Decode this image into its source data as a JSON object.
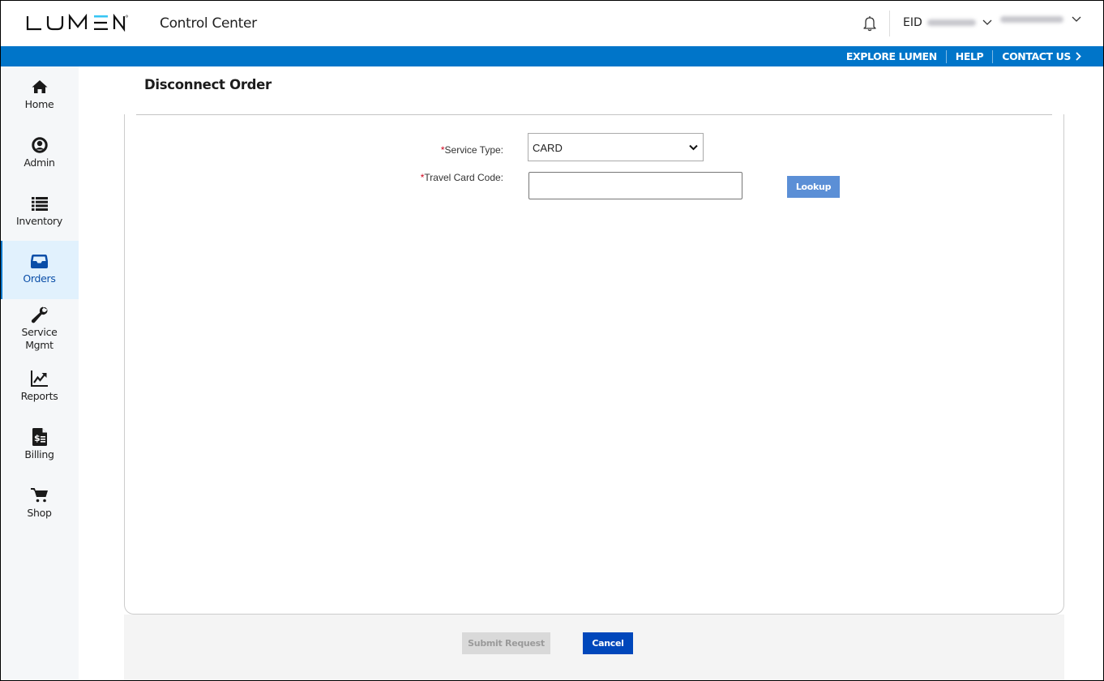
{
  "header": {
    "brand": "LUMEN",
    "app_title": "Control Center",
    "notifications_icon": "bell-icon",
    "eid_label": "EID",
    "eid_value_redacted": true,
    "username_redacted": true
  },
  "top_nav": {
    "items": [
      {
        "label": "EXPLORE LUMEN"
      },
      {
        "label": "HELP"
      },
      {
        "label": "CONTACT US"
      }
    ]
  },
  "sidebar": {
    "items": [
      {
        "label": "Home",
        "icon": "home-icon",
        "active": false
      },
      {
        "label": "Admin",
        "icon": "user-circle-icon",
        "active": false
      },
      {
        "label": "Inventory",
        "icon": "list-icon",
        "active": false
      },
      {
        "label": "Orders",
        "icon": "inbox-tray-icon",
        "active": true
      },
      {
        "label": "Service Mgmt",
        "icon": "wrench-icon",
        "active": false
      },
      {
        "label": "Reports",
        "icon": "chart-trend-icon",
        "active": false
      },
      {
        "label": "Billing",
        "icon": "invoice-dollar-icon",
        "active": false
      },
      {
        "label": "Shop",
        "icon": "cart-icon",
        "active": false
      }
    ]
  },
  "page": {
    "title": "Disconnect Order"
  },
  "form": {
    "required_marker": "*",
    "service_type": {
      "label": "Service Type:",
      "selected": "CARD"
    },
    "travel_card_code": {
      "label": "Travel Card Code:",
      "value": "",
      "placeholder": ""
    },
    "lookup_label": "Lookup"
  },
  "footer": {
    "submit_label": "Submit Request",
    "submit_disabled": true,
    "cancel_label": "Cancel"
  },
  "colors": {
    "brand_blue": "#0075c9",
    "logo_accent": "#38c6f4",
    "active_nav_bg": "#e1f1fd",
    "active_nav_text": "#0a4ea8",
    "required": "#d0021b",
    "lookup_button": "#5b8fd6",
    "cancel_button": "#0047bb",
    "submit_disabled": "#d9d9d9"
  }
}
